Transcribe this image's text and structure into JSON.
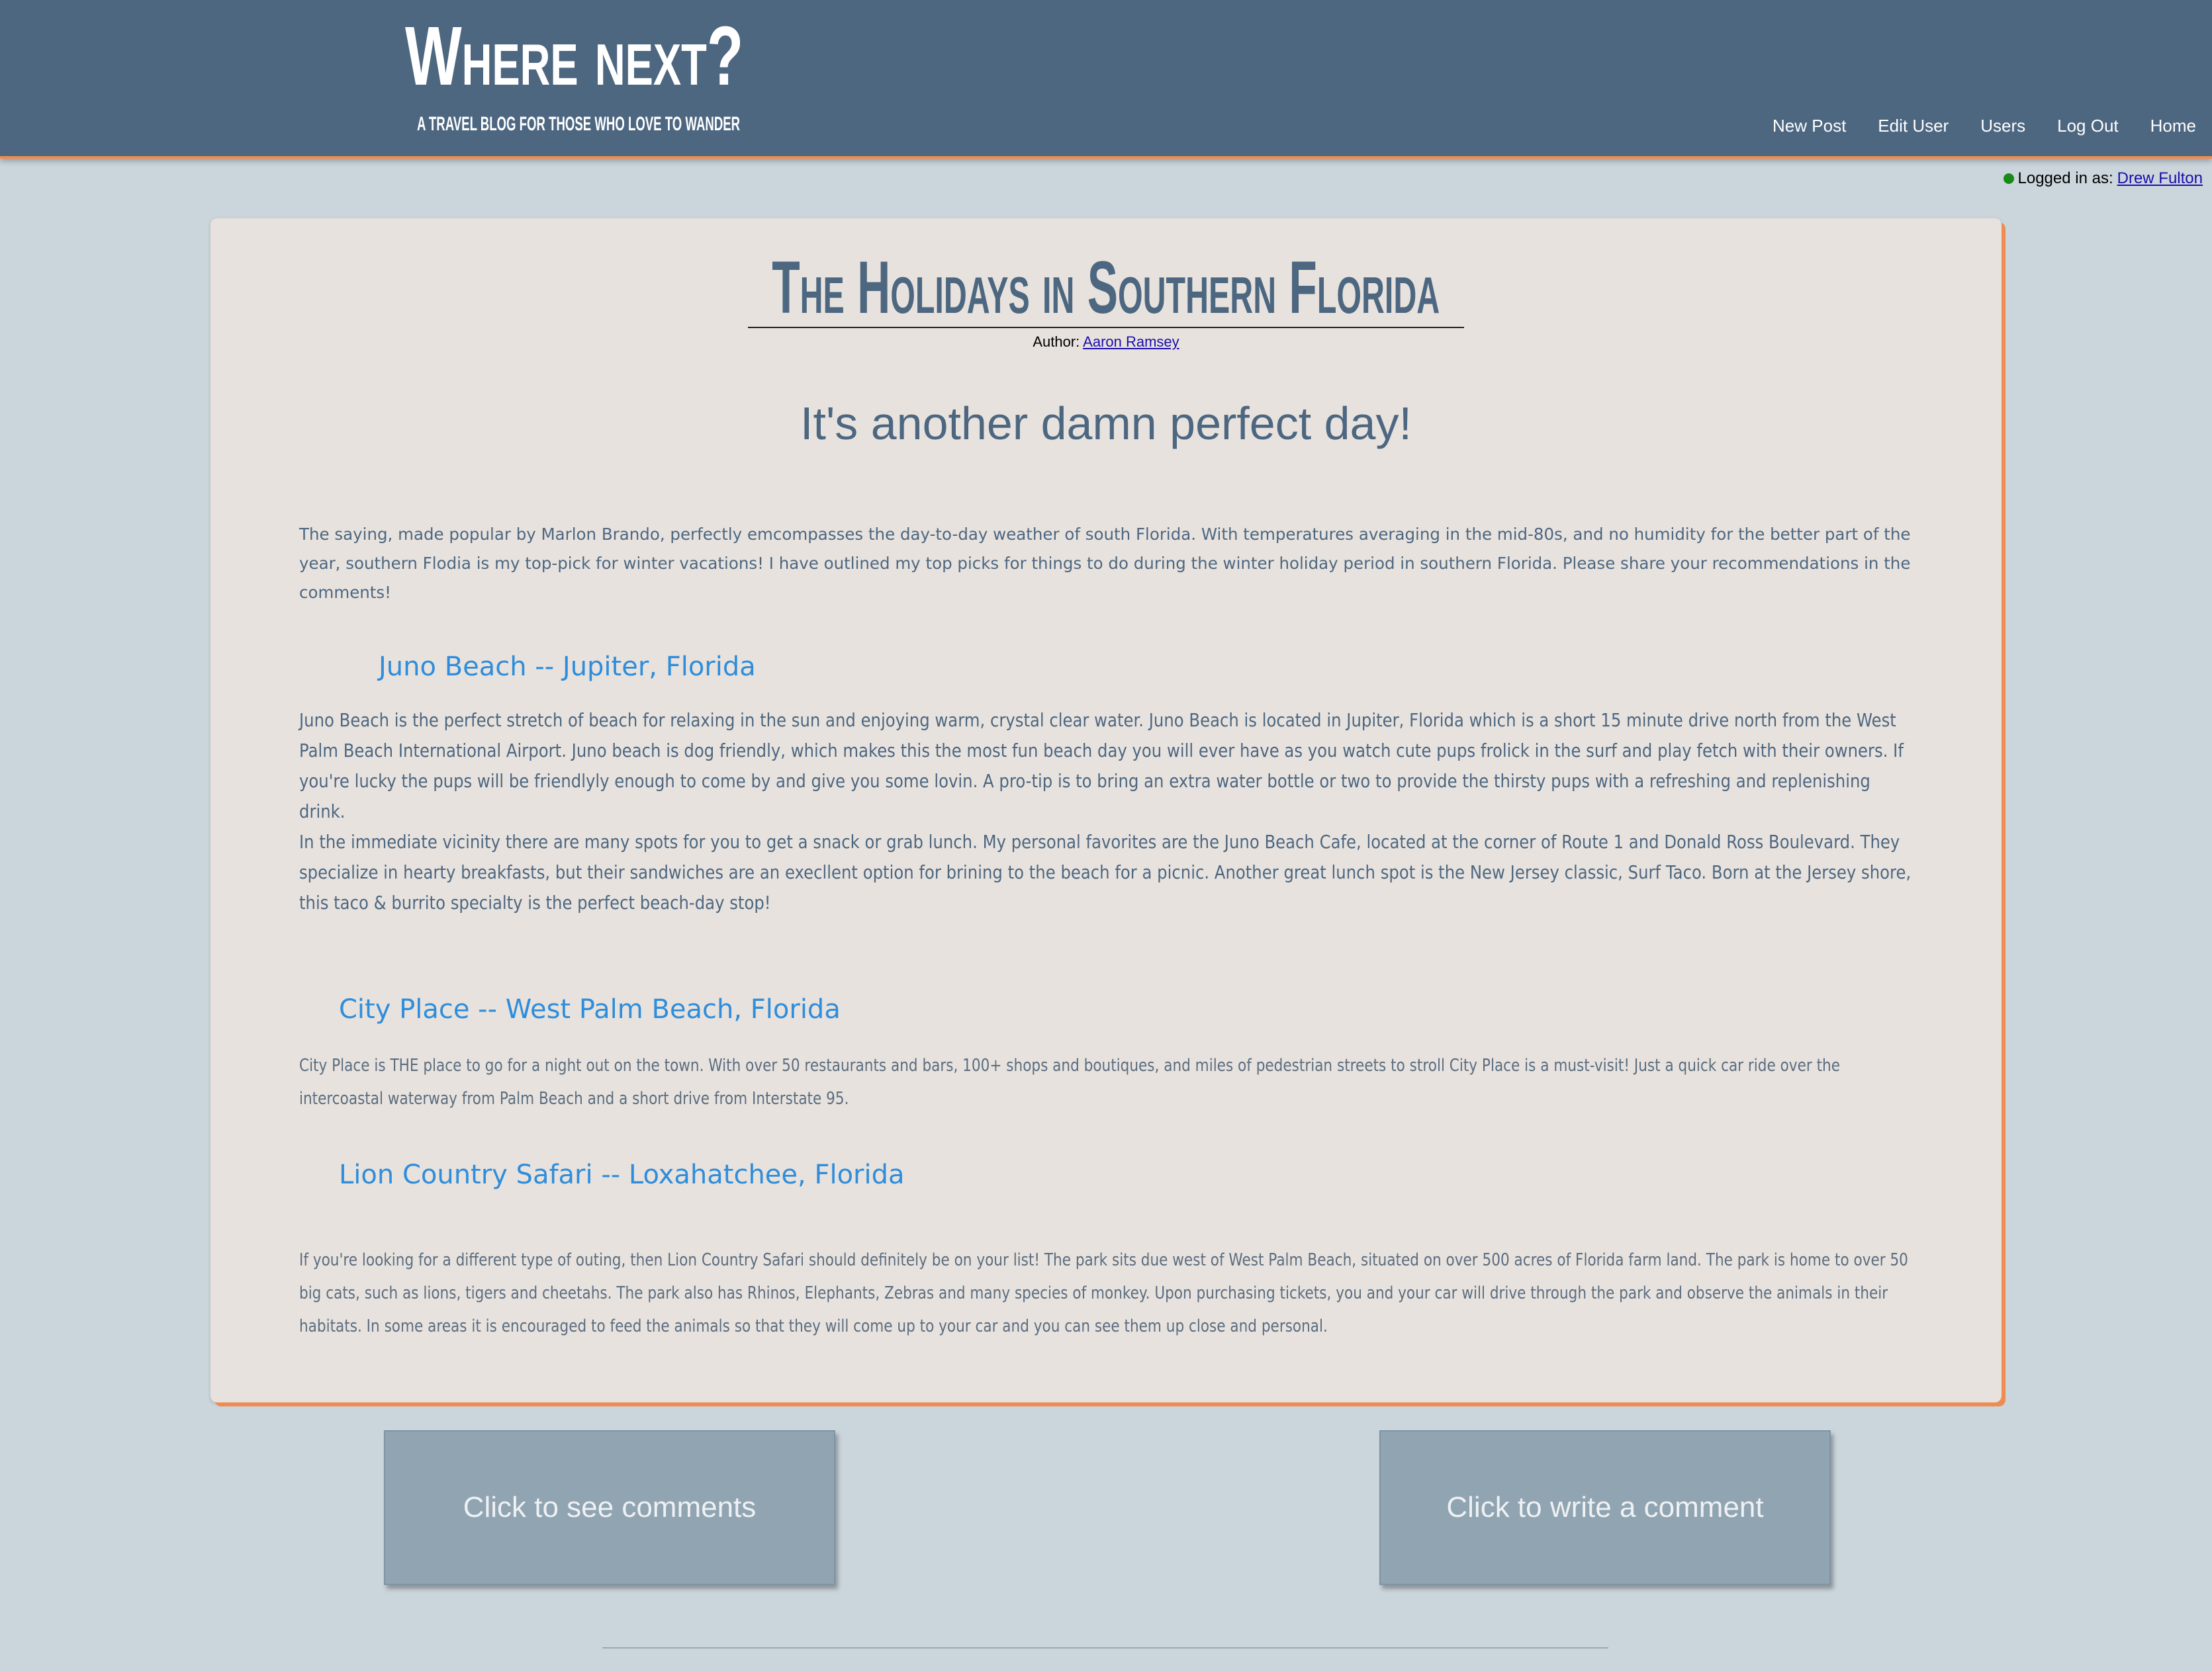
{
  "header": {
    "site_title": "Where next?",
    "tagline": "A travel blog for those who love to wander",
    "nav": [
      "New Post",
      "Edit User",
      "Users",
      "Log Out",
      "Home"
    ]
  },
  "session": {
    "label": "Logged in as:",
    "user": "Drew Fulton",
    "status_color": "#178a17"
  },
  "post": {
    "title": "The Holidays in Southern Florida",
    "author_label": "Author:",
    "author": "Aaron Ramsey",
    "subtitle": "It's another damn perfect day!",
    "intro": "The saying, made popular by Marlon Brando, perfectly emcompasses the day-to-day weather of south Florida. With temperatures averaging in the mid-80s, and no humidity for the better part of the year, southern Flodia is my top-pick for winter vacations! I have outlined my top picks for things to do during the winter holiday period in southern Florida. Please share your recommendations in the comments!",
    "sections": [
      {
        "heading": "Juno Beach -- Jupiter, Florida",
        "paragraphs": [
          "Juno Beach is the perfect stretch of beach for relaxing in the sun and enjoying warm, crystal clear water. Juno Beach is located in Jupiter, Florida which is a short 15 minute drive north from the West Palm Beach International Airport. Juno beach is dog friendly, which makes this the most fun beach day you will ever have as you watch cute pups frolick in the surf and play fetch with their owners. If you're lucky the pups will be friendlyly enough to come by and give you some lovin. A pro-tip is to bring an extra water bottle or two to provide the thirsty pups with a refreshing and replenishing drink.",
          "In the immediate vicinity there are many spots for you to get a snack or grab lunch. My personal favorites are the Juno Beach Cafe, located at the corner of Route 1 and Donald Ross Boulevard. They specialize in hearty breakfasts, but their sandwiches are an execllent option for brining to the beach for a picnic. Another great lunch spot is the New Jersey classic, Surf Taco. Born at the Jersey shore, this taco & burrito specialty is the perfect beach-day stop!"
        ]
      },
      {
        "heading": "City Place -- West Palm Beach, Florida",
        "paragraphs": [
          "City Place is THE place to go for a night out on the town. With over 50 restaurants and bars, 100+ shops and boutiques, and miles of pedestrian streets to stroll City Place is a must-visit! Just a quick car ride over the intercoastal waterway from Palm Beach and a short drive from Interstate 95."
        ]
      },
      {
        "heading": "Lion Country Safari -- Loxahatchee, Florida",
        "paragraphs": [
          "If you're looking for a different type of outing, then Lion Country Safari should definitely be on your list! The park sits due west of West Palm Beach, situated on over 500 acres of Florida farm land. The park is home to over 50 big cats, such as lions, tigers and cheetahs. The park also has Rhinos, Elephants, Zebras and many species of monkey. Upon purchasing tickets, you and your car will drive through the park and observe the animals in their habitats. In some areas it is encouraged to feed the animals so that they will come up to your car and you can see them up close and personal."
        ]
      }
    ]
  },
  "actions": {
    "see_comments": "Click to see comments",
    "write_comment": "Click to write a comment"
  },
  "colors": {
    "header_bg": "#4d6781",
    "accent": "#f08c52",
    "section_heading": "#2f8ddb",
    "page_bg": "#cbd5dc",
    "card_bg": "#e7e2dd"
  }
}
